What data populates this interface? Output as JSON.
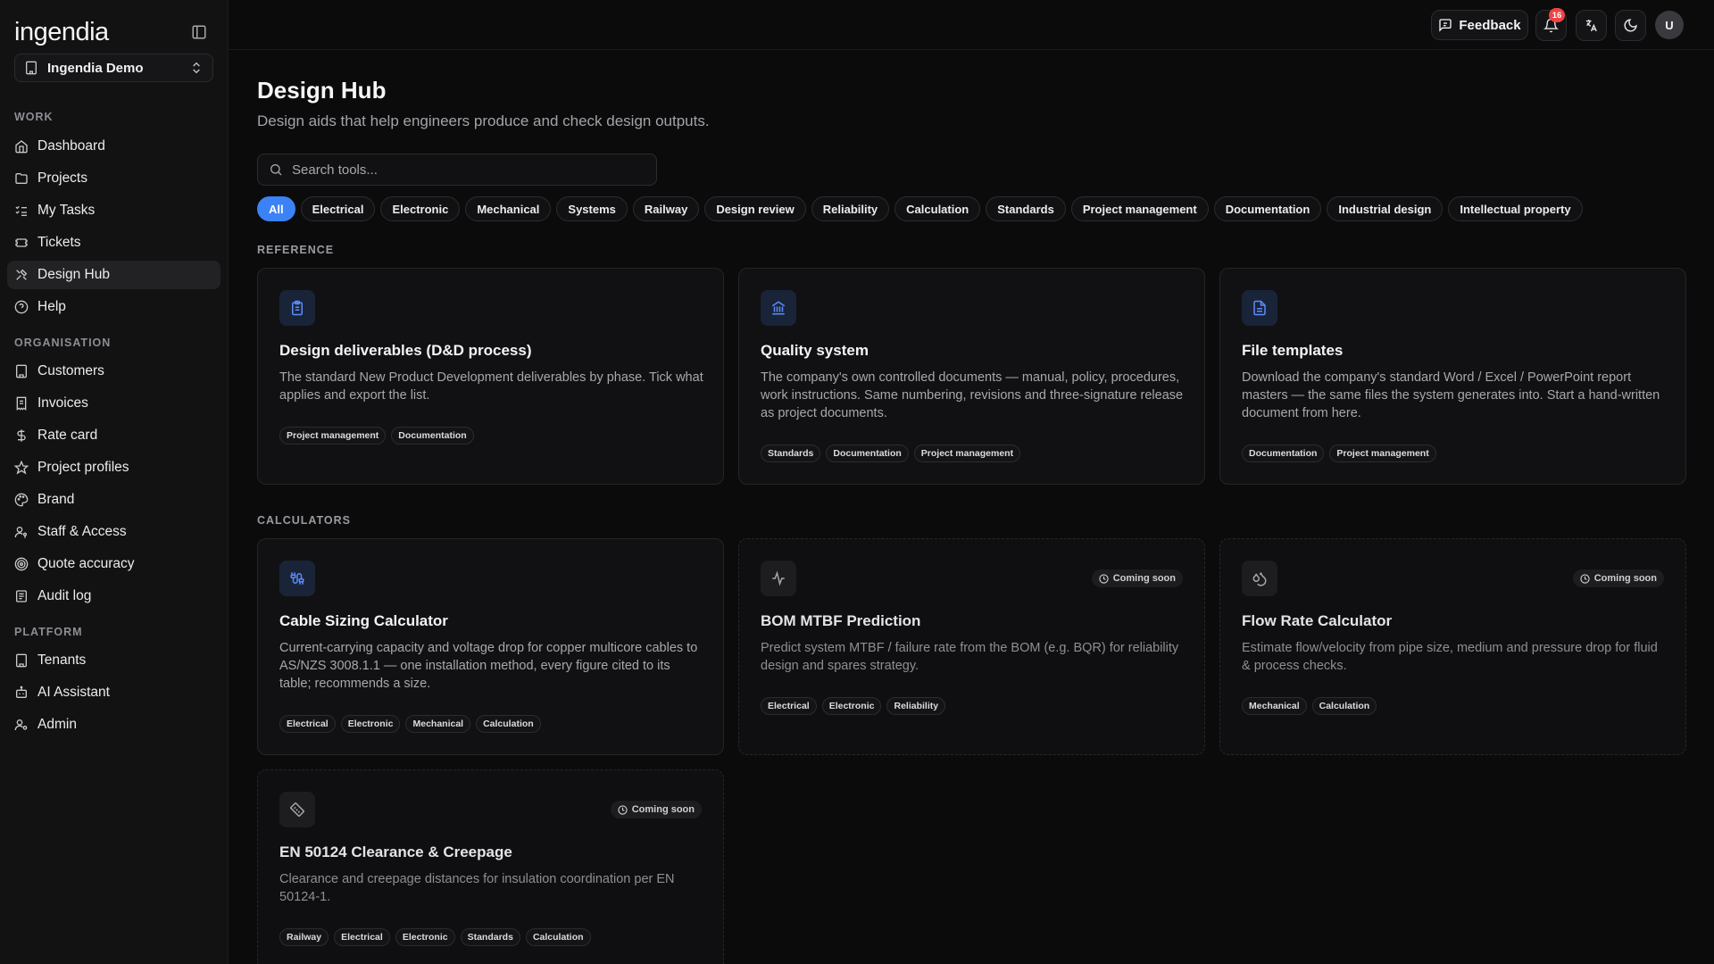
{
  "app": {
    "logo_text": "ingendia",
    "workspace": "Ingendia Demo"
  },
  "sidebar": {
    "sections": [
      {
        "label": "WORK"
      },
      {
        "label": "ORGANISATION"
      },
      {
        "label": "PLATFORM"
      }
    ],
    "items": [
      {
        "label": "Dashboard",
        "icon": "home-icon"
      },
      {
        "label": "Projects",
        "icon": "folder-icon"
      },
      {
        "label": "My Tasks",
        "icon": "list-checks-icon"
      },
      {
        "label": "Tickets",
        "icon": "ticket-icon"
      },
      {
        "label": "Design Hub",
        "icon": "tools-icon",
        "active": true
      },
      {
        "label": "Help",
        "icon": "help-circle-icon"
      },
      {
        "label": "Customers",
        "icon": "building-icon"
      },
      {
        "label": "Invoices",
        "icon": "receipt-icon"
      },
      {
        "label": "Rate card",
        "icon": "dollar-icon"
      },
      {
        "label": "Project profiles",
        "icon": "star-icon"
      },
      {
        "label": "Brand",
        "icon": "palette-icon"
      },
      {
        "label": "Staff & Access",
        "icon": "user-key-icon"
      },
      {
        "label": "Quote accuracy",
        "icon": "target-icon"
      },
      {
        "label": "Audit log",
        "icon": "log-icon"
      },
      {
        "label": "Tenants",
        "icon": "building-icon"
      },
      {
        "label": "AI Assistant",
        "icon": "bot-icon"
      },
      {
        "label": "Admin",
        "icon": "user-cog-icon"
      }
    ]
  },
  "topbar": {
    "feedback_label": "Feedback",
    "notification_count": "16",
    "avatar_initial": "U"
  },
  "page": {
    "title": "Design Hub",
    "subtitle": "Design aids that help engineers produce and check design outputs.",
    "search_placeholder": "Search tools..."
  },
  "filters": [
    "All",
    "Electrical",
    "Electronic",
    "Mechanical",
    "Systems",
    "Railway",
    "Design review",
    "Reliability",
    "Calculation",
    "Standards",
    "Project management",
    "Documentation",
    "Industrial design",
    "Intellectual property"
  ],
  "active_filter": "All",
  "sections": {
    "reference": "REFERENCE",
    "calculators": "CALCULATORS"
  },
  "coming_soon_label": "Coming soon",
  "cards": [
    {
      "title": "Design deliverables (D&D process)",
      "description": "The standard New Product Development deliverables by phase. Tick what applies and export the list.",
      "tags": [
        "Project management",
        "Documentation"
      ],
      "icon": "clipboard-icon",
      "coming_soon": false
    },
    {
      "title": "Quality system",
      "description": "The company's own controlled documents — manual, policy, procedures, work instructions. Same numbering, revisions and three-signature release as project documents.",
      "tags": [
        "Standards",
        "Documentation",
        "Project management"
      ],
      "icon": "landmark-icon",
      "coming_soon": false
    },
    {
      "title": "File templates",
      "description": "Download the company's standard Word / Excel / PowerPoint report masters — the same files the system generates into. Start a hand-written document from here.",
      "tags": [
        "Documentation",
        "Project management"
      ],
      "icon": "file-text-icon",
      "coming_soon": false
    },
    {
      "title": "Cable Sizing Calculator",
      "description": "Current-carrying capacity and voltage drop for copper multicore cables to AS/NZS 3008.1.1 — one installation method, every figure cited to its table; recommends a size.",
      "tags": [
        "Electrical",
        "Electronic",
        "Mechanical",
        "Calculation"
      ],
      "icon": "cable-icon",
      "coming_soon": false
    },
    {
      "title": "BOM MTBF Prediction",
      "description": "Predict system MTBF / failure rate from the BOM (e.g. BQR) for reliability design and spares strategy.",
      "tags": [
        "Electrical",
        "Electronic",
        "Reliability"
      ],
      "icon": "activity-icon",
      "coming_soon": true
    },
    {
      "title": "Flow Rate Calculator",
      "description": "Estimate flow/velocity from pipe size, medium and pressure drop for fluid & process checks.",
      "tags": [
        "Mechanical",
        "Calculation"
      ],
      "icon": "droplets-icon",
      "coming_soon": true
    },
    {
      "title": "EN 50124 Clearance & Creepage",
      "description": "Clearance and creepage distances for insulation coordination per EN 50124-1.",
      "tags": [
        "Railway",
        "Electrical",
        "Electronic",
        "Standards",
        "Calculation"
      ],
      "icon": "ruler-icon",
      "coming_soon": true
    }
  ],
  "colors": {
    "background": "#0b0b0c",
    "sidebar": "#121213",
    "accent": "#3b82f6",
    "badge": "#ef4444"
  }
}
